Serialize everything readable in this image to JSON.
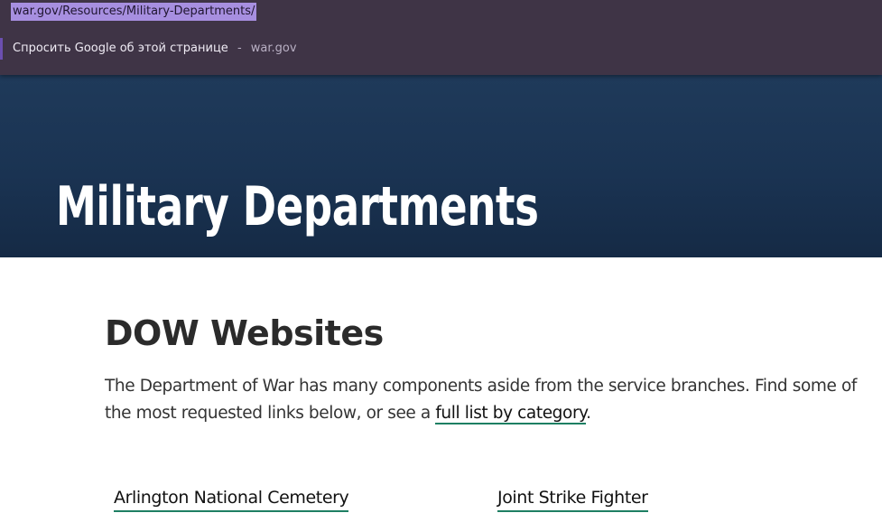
{
  "omnibox": {
    "url": "war.gov/Resources/Military-Departments/",
    "suggestion_text": "Спросить Google об этой странице",
    "suggestion_separator": "-",
    "suggestion_domain": "war.gov"
  },
  "hero": {
    "title": "Military Departments"
  },
  "section": {
    "heading": "DOW Websites",
    "intro_before_link": "The Department of War has many components aside from the service branches. Find some of the most requested links below, or see a ",
    "intro_link": "full list by category",
    "intro_after_link": "."
  },
  "links": [
    {
      "label": "Arlington National Cemetery"
    },
    {
      "label": "Joint Strike Fighter"
    }
  ],
  "colors": {
    "dropdown_bg": "#3f3446",
    "hero_bg": "#1a3352",
    "link_underline": "#1e7f63"
  }
}
